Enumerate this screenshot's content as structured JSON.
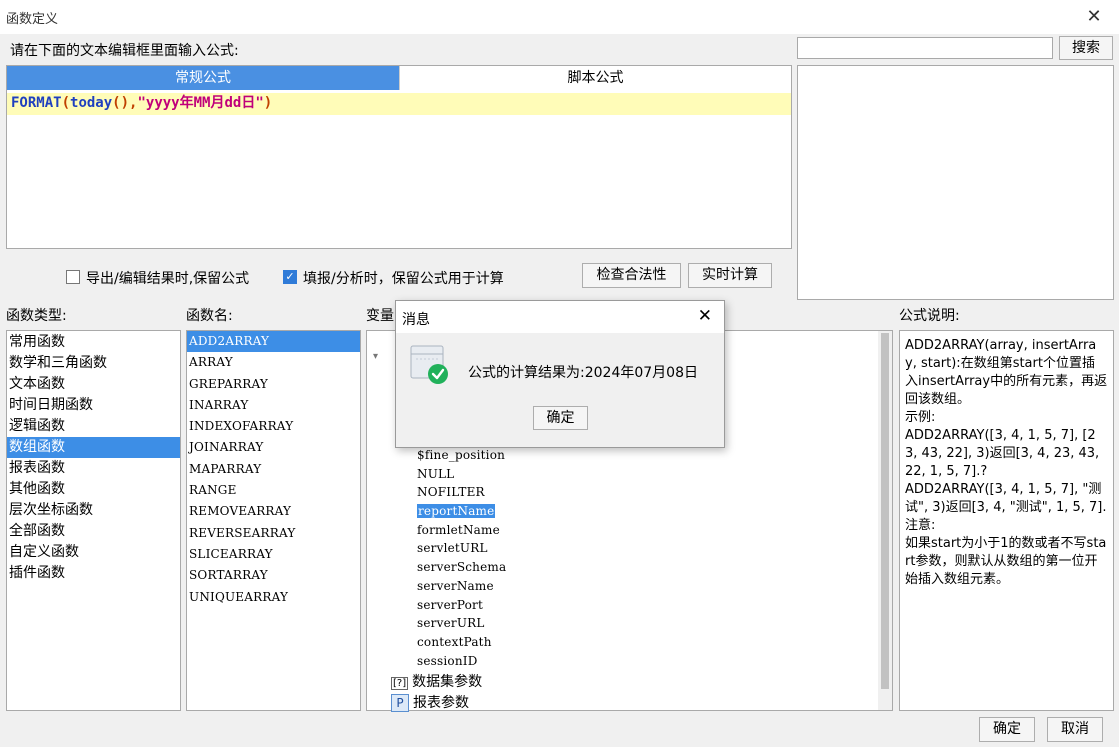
{
  "window": {
    "title": "函数定义",
    "close_glyph": "✕"
  },
  "editor": {
    "prompt": "请在下面的文本编辑框里面输入公式:",
    "tabs": [
      {
        "label": "常规公式",
        "active": true
      },
      {
        "label": "脚本公式",
        "active": false
      }
    ],
    "formula": {
      "func": "FORMAT",
      "open": "(",
      "inner_func": "today",
      "inner_parens": "()",
      "comma": ",",
      "string": "\"yyyy年MM月dd日\"",
      "close": ")"
    }
  },
  "search": {
    "value": "",
    "button": "搜索"
  },
  "options": {
    "keep_formula_export": {
      "label": "导出/编辑结果时,保留公式",
      "checked": false
    },
    "keep_formula_fill": {
      "label": "填报/分析时，保留公式用于计算",
      "checked": true
    },
    "check_button": "检查合法性",
    "realtime_button": "实时计算"
  },
  "function_types": {
    "label": "函数类型:",
    "items": [
      "常用函数",
      "数学和三角函数",
      "文本函数",
      "时间日期函数",
      "逻辑函数",
      "数组函数",
      "报表函数",
      "其他函数",
      "层次坐标函数",
      "全部函数",
      "自定义函数",
      "插件函数"
    ],
    "selected": "数组函数"
  },
  "function_names": {
    "label": "函数名:",
    "items": [
      "ADD2ARRAY",
      "ARRAY",
      "GREPARRAY",
      "INARRAY",
      "INDEXOFARRAY",
      "JOINARRAY",
      "MAPARRAY",
      "RANGE",
      "REMOVEARRAY",
      "REVERSEARRAY",
      "SLICEARRAY",
      "SORTARRAY",
      "UNIQUEARRAY"
    ],
    "selected": "ADD2ARRAY"
  },
  "variables": {
    "label": "变量",
    "items": [
      "$fine_position",
      "NULL",
      "NOFILTER",
      "reportName",
      "formletName",
      "servletURL",
      "serverSchema",
      "serverName",
      "serverPort",
      "serverURL",
      "contextPath",
      "sessionID"
    ],
    "selected": "reportName",
    "groups": [
      {
        "icon": "dataset-param-icon",
        "glyph": "[?]",
        "label": "数据集参数"
      },
      {
        "icon": "report-param-icon",
        "glyph": "P",
        "label": "报表参数"
      }
    ]
  },
  "description": {
    "label": "公式说明:",
    "text": "ADD2ARRAY(array, insertArray, start):在数组第start个位置插\n入insertArray中的所有元素，再返回该数组。\n示例:\nADD2ARRAY([3, 4, 1, 5, 7], [23, 43, 22], 3)返回[3, 4, 23, 43, 22, 1, 5, 7].?\nADD2ARRAY([3, 4, 1, 5, 7], \"测试\", 3)返回[3, 4, \"测试\", 1, 5, 7].\n注意:\n如果start为小于1的数或者不写start参数，则默认从数组的第一位开始插入数组元素。"
  },
  "footer": {
    "ok": "确定",
    "cancel": "取消"
  },
  "message_dialog": {
    "title": "消息",
    "close_glyph": "✕",
    "message": "公式的计算结果为:2024年07月08日",
    "ok": "确定",
    "icon": "success-icon",
    "accent": "#21b15b"
  },
  "colors": {
    "selection": "#3d8ee6",
    "tab_active": "#4a90e2",
    "formula_bg": "#fffcb8"
  }
}
